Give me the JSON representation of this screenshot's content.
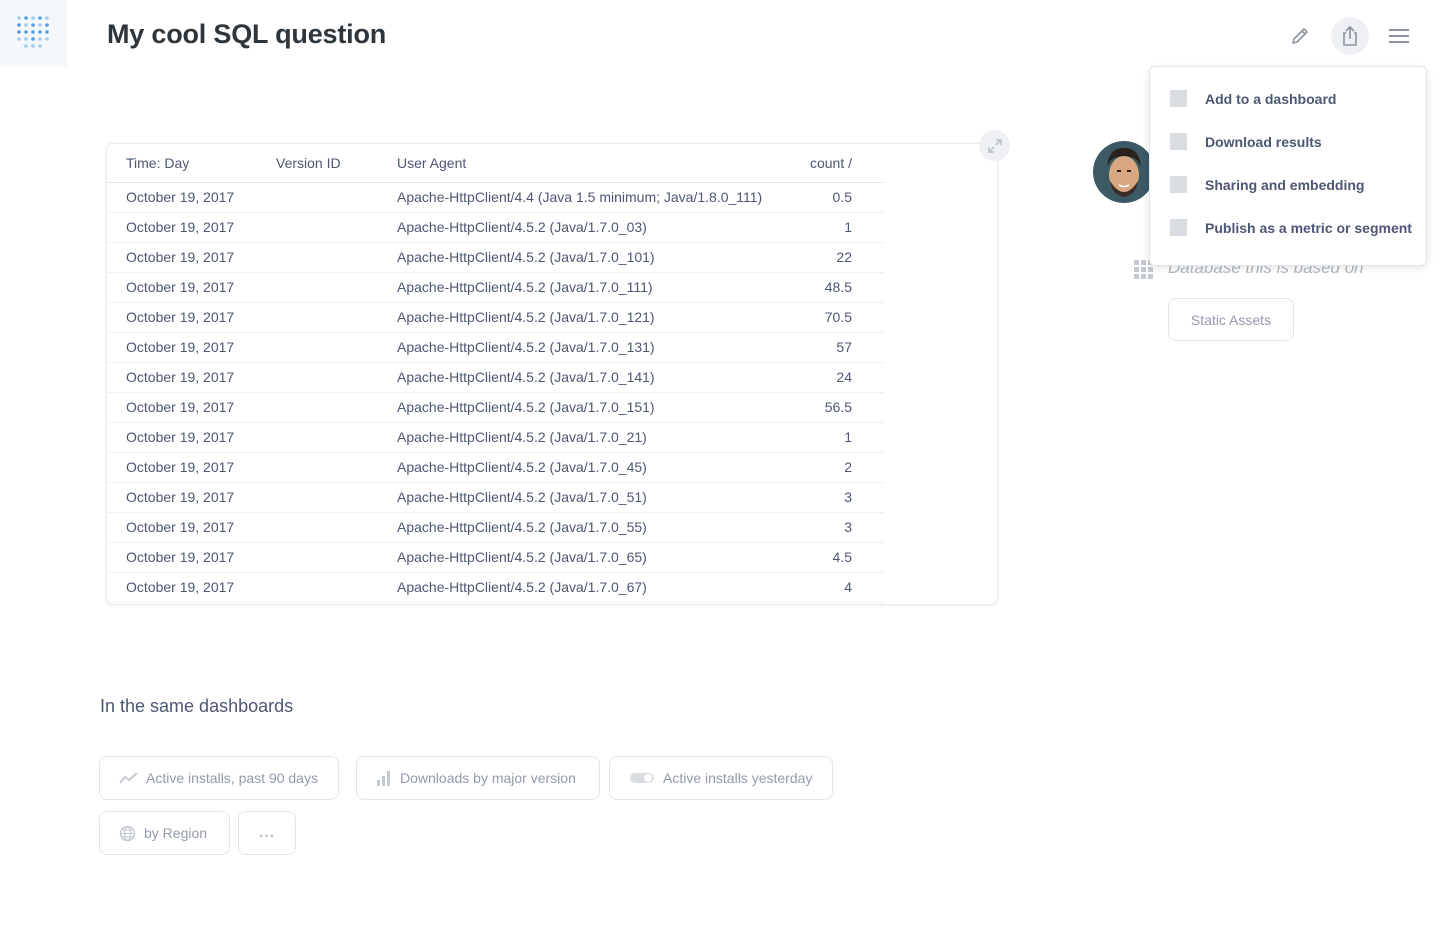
{
  "header": {
    "title": "My cool SQL question",
    "icons": [
      "pencil-icon",
      "share-icon",
      "menu-icon"
    ]
  },
  "table": {
    "columns": [
      "Time: Day",
      "Version ID",
      "User Agent",
      "count /"
    ],
    "rows": [
      [
        "October 19, 2017",
        "",
        "Apache-HttpClient/4.4 (Java 1.5 minimum; Java/1.8.0_111)",
        "0.5"
      ],
      [
        "October 19, 2017",
        "",
        "Apache-HttpClient/4.5.2 (Java/1.7.0_03)",
        "1"
      ],
      [
        "October 19, 2017",
        "",
        "Apache-HttpClient/4.5.2 (Java/1.7.0_101)",
        "22"
      ],
      [
        "October 19, 2017",
        "",
        "Apache-HttpClient/4.5.2 (Java/1.7.0_111)",
        "48.5"
      ],
      [
        "October 19, 2017",
        "",
        "Apache-HttpClient/4.5.2 (Java/1.7.0_121)",
        "70.5"
      ],
      [
        "October 19, 2017",
        "",
        "Apache-HttpClient/4.5.2 (Java/1.7.0_131)",
        "57"
      ],
      [
        "October 19, 2017",
        "",
        "Apache-HttpClient/4.5.2 (Java/1.7.0_141)",
        "24"
      ],
      [
        "October 19, 2017",
        "",
        "Apache-HttpClient/4.5.2 (Java/1.7.0_151)",
        "56.5"
      ],
      [
        "October 19, 2017",
        "",
        "Apache-HttpClient/4.5.2 (Java/1.7.0_21)",
        "1"
      ],
      [
        "October 19, 2017",
        "",
        "Apache-HttpClient/4.5.2 (Java/1.7.0_45)",
        "2"
      ],
      [
        "October 19, 2017",
        "",
        "Apache-HttpClient/4.5.2 (Java/1.7.0_51)",
        "3"
      ],
      [
        "October 19, 2017",
        "",
        "Apache-HttpClient/4.5.2 (Java/1.7.0_55)",
        "3"
      ],
      [
        "October 19, 2017",
        "",
        "Apache-HttpClient/4.5.2 (Java/1.7.0_65)",
        "4.5"
      ],
      [
        "October 19, 2017",
        "",
        "Apache-HttpClient/4.5.2 (Java/1.7.0_67)",
        "4"
      ]
    ]
  },
  "share_menu": {
    "items": [
      {
        "label": "Add to a dashboard"
      },
      {
        "label": "Download results"
      },
      {
        "label": "Sharing and embedding"
      },
      {
        "label": "Publish as a metric or segment"
      }
    ]
  },
  "sidebar": {
    "database_text": "Database this is based on",
    "database_button": "Static Assets"
  },
  "related": {
    "title": "In the same dashboards",
    "chips": [
      {
        "label": "Active installs, past 90 days",
        "icon": "line-chart-icon"
      },
      {
        "label": "Downloads by major version",
        "icon": "bar-chart-icon"
      },
      {
        "label": "Active installs yesterday",
        "icon": "toggle-icon"
      },
      {
        "label": "by Region",
        "icon": "globe-icon"
      },
      {
        "label": "...",
        "icon": "more-icon"
      }
    ]
  },
  "colors": {
    "brand": "#509ee3",
    "text": "#4c5773",
    "title": "#2e353b",
    "muted": "#949aab"
  }
}
